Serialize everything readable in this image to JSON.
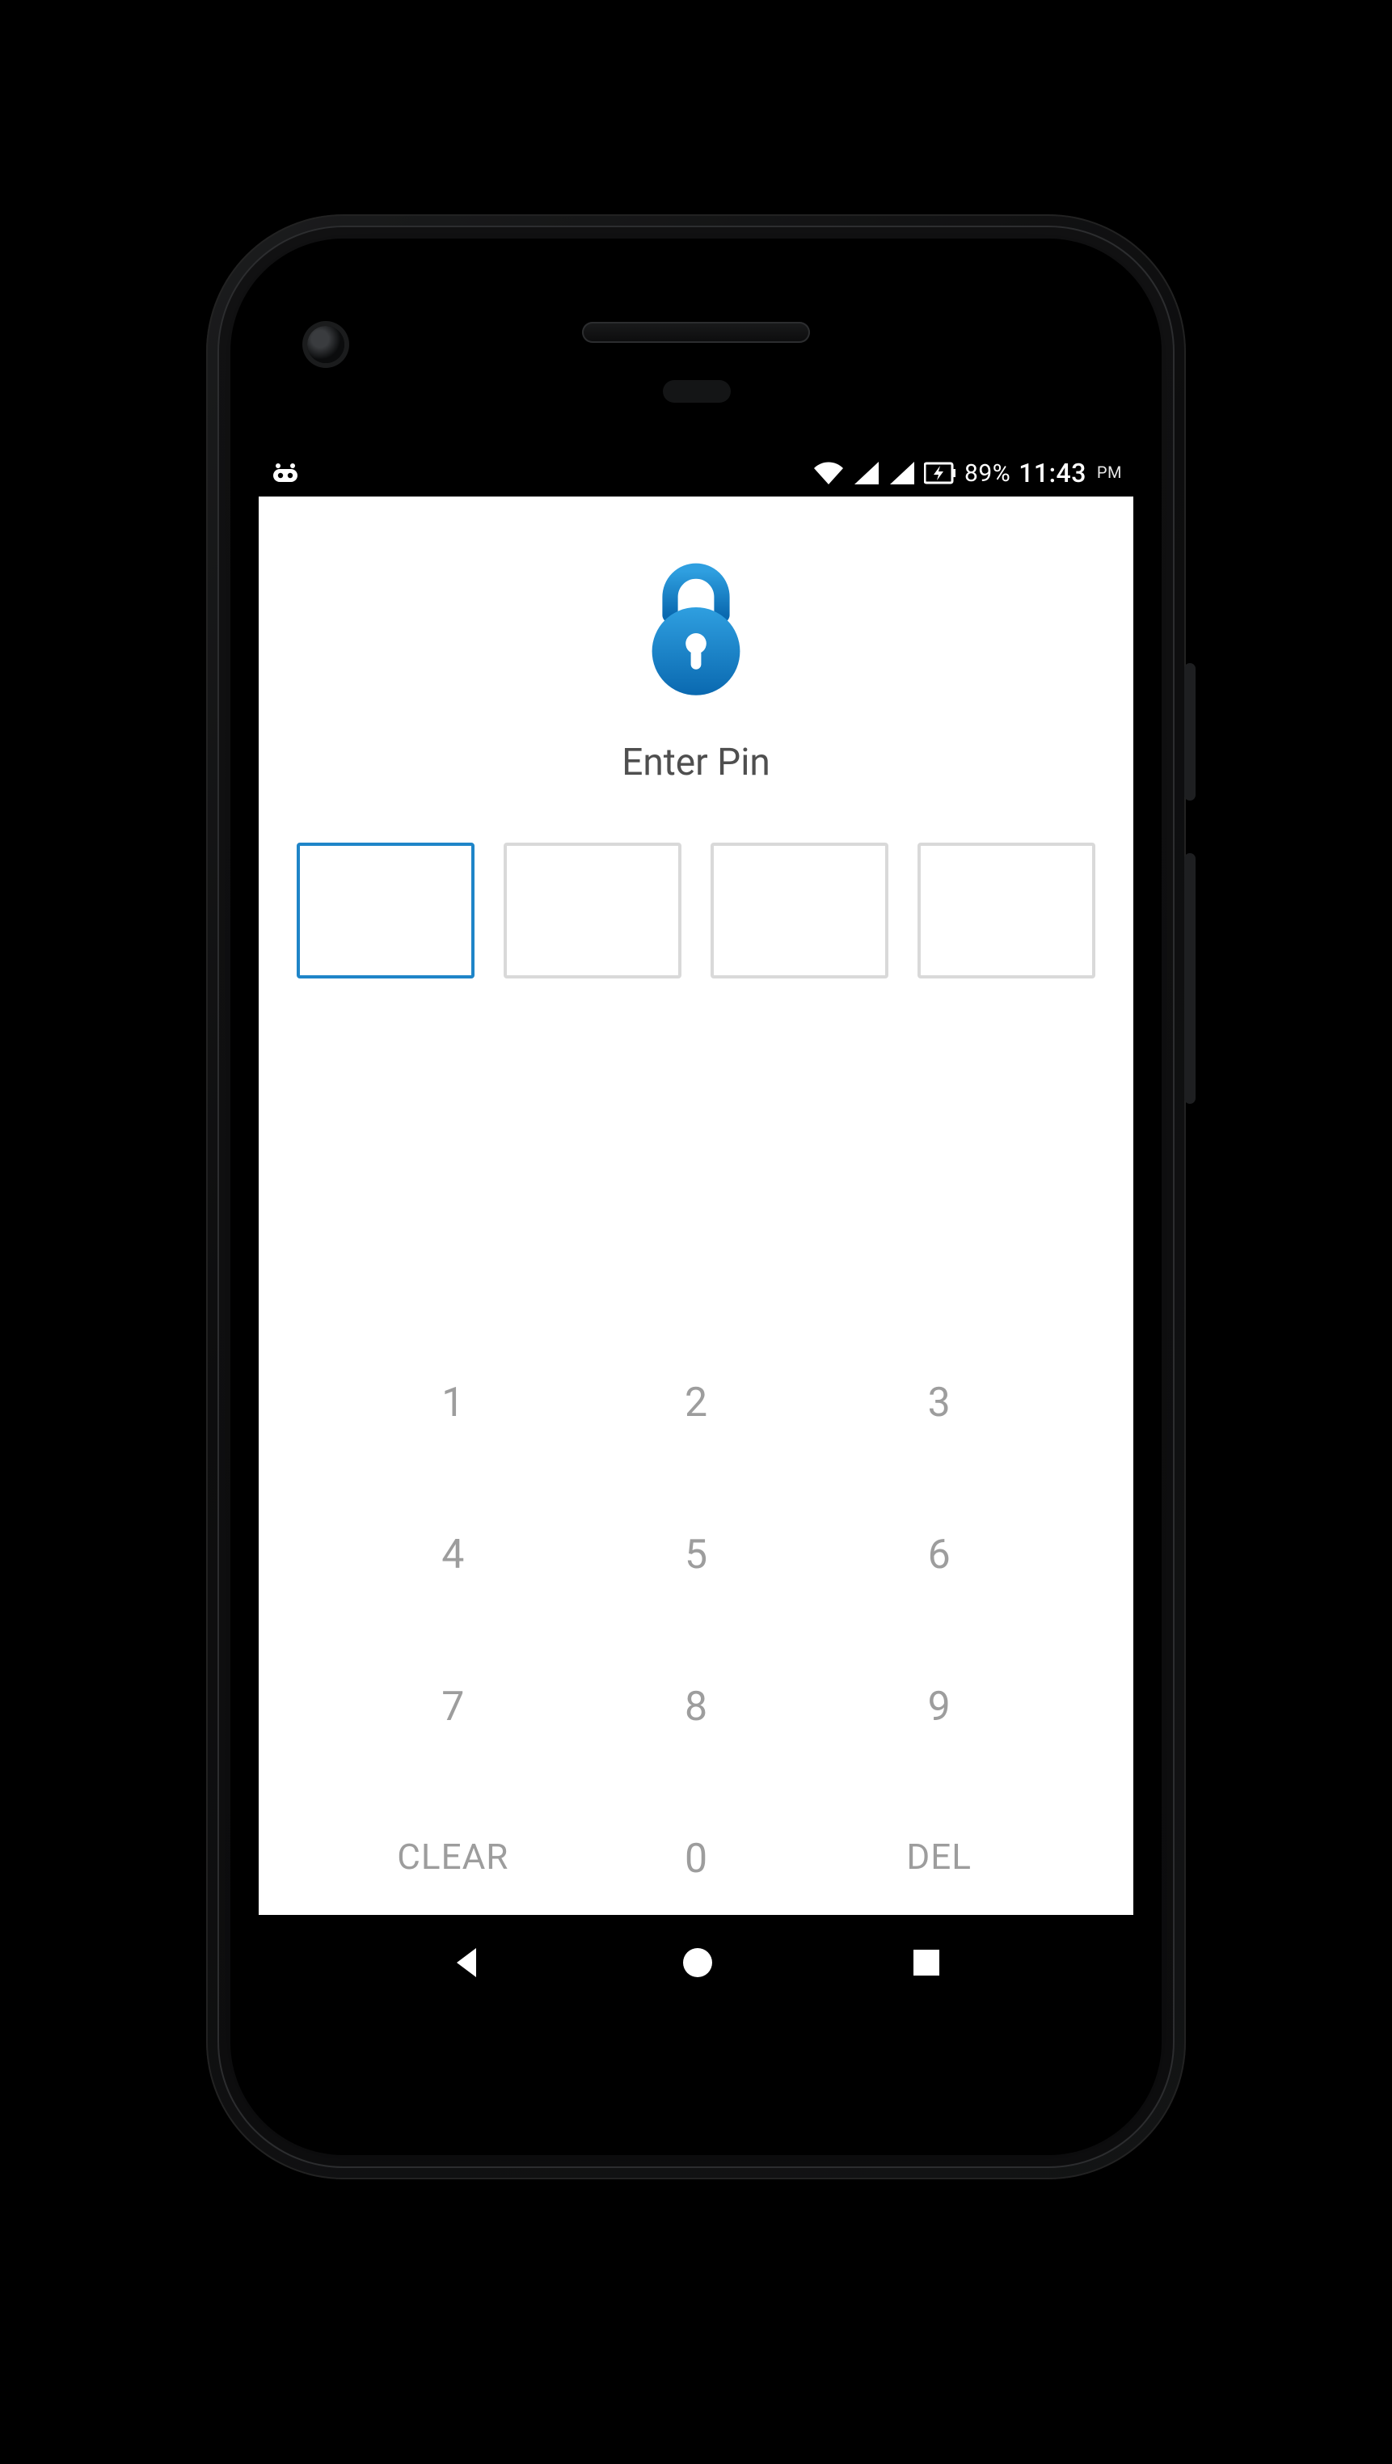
{
  "statusbar": {
    "battery_percent": "89%",
    "time": "11:43",
    "ampm": "PM"
  },
  "lockscreen": {
    "prompt": "Enter Pin",
    "pin_length": 4,
    "active_index": 0
  },
  "keypad": {
    "keys": [
      "1",
      "2",
      "3",
      "4",
      "5",
      "6",
      "7",
      "8",
      "9"
    ],
    "clear": "CLEAR",
    "zero": "0",
    "del": "DEL"
  },
  "colors": {
    "accent": "#1f85c8",
    "key_text": "#9d9d9d"
  }
}
